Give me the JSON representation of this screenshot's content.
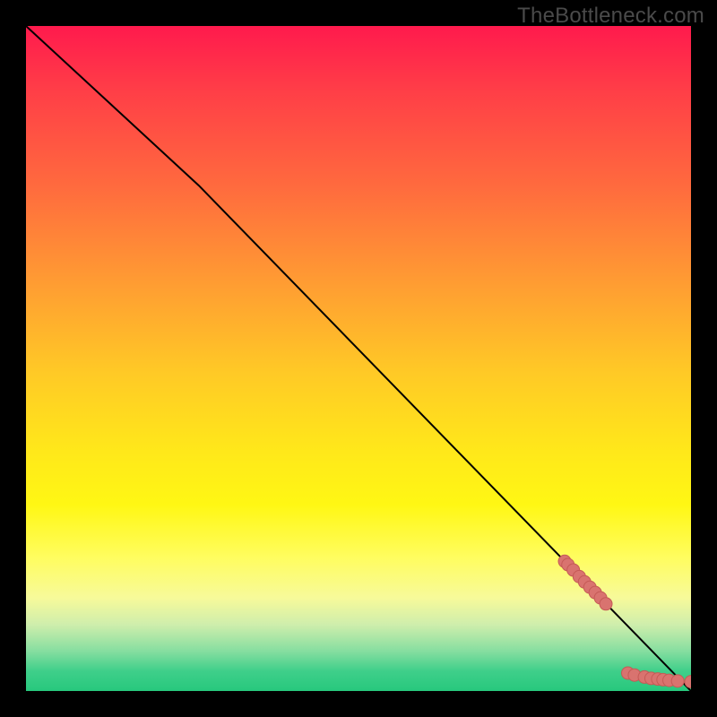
{
  "watermark": "TheBottleneck.com",
  "colors": {
    "frame": "#000000",
    "line": "#000000",
    "marker_fill": "#d9736f",
    "marker_stroke": "#c55a56"
  },
  "chart_data": {
    "type": "line",
    "title": "",
    "xlabel": "",
    "ylabel": "",
    "xlim": [
      0,
      100
    ],
    "ylim": [
      0,
      100
    ],
    "series": [
      {
        "name": "curve",
        "x": [
          0,
          26,
          100
        ],
        "y": [
          100,
          76,
          0
        ],
        "style": "line"
      },
      {
        "name": "points-upper-cluster",
        "x": [
          81.0,
          81.5,
          82.3,
          83.2,
          84.0,
          84.8,
          85.6,
          86.4,
          87.2
        ],
        "y": [
          19.5,
          19.0,
          18.2,
          17.2,
          16.4,
          15.6,
          14.8,
          14.0,
          13.1
        ],
        "style": "scatter"
      },
      {
        "name": "points-lower-cluster",
        "x": [
          90.5,
          91.5,
          93.0,
          94.0,
          95.0,
          95.8,
          96.7,
          98.0
        ],
        "y": [
          2.7,
          2.4,
          2.1,
          1.9,
          1.8,
          1.7,
          1.6,
          1.5
        ],
        "style": "scatter"
      },
      {
        "name": "point-isolated",
        "x": [
          100
        ],
        "y": [
          1.4
        ],
        "style": "scatter"
      }
    ]
  }
}
